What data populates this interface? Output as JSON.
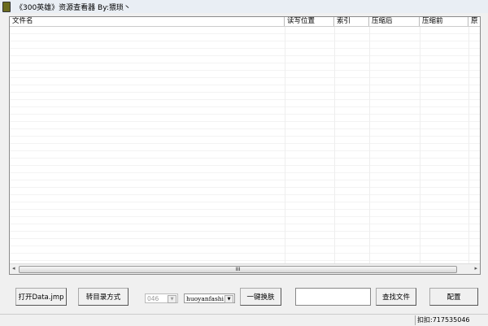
{
  "window": {
    "title": "《300英雄》资源查看器    By:猥琐丶"
  },
  "list": {
    "columns": [
      "文件名",
      "读写位置",
      "索引",
      "压缩后",
      "压缩前",
      "原"
    ],
    "rows": []
  },
  "scrollbar": {
    "grip": "III"
  },
  "toolbar": {
    "open_label": "打开Data.jmp",
    "dir_mode_label": "转目录方式",
    "version_value": "046",
    "hero_value": "huoyanfashi",
    "swap_label": "一键换肤",
    "search_value": "",
    "find_label": "查找文件",
    "config_label": "配置"
  },
  "status": {
    "qq": "扣扣:717535046"
  }
}
